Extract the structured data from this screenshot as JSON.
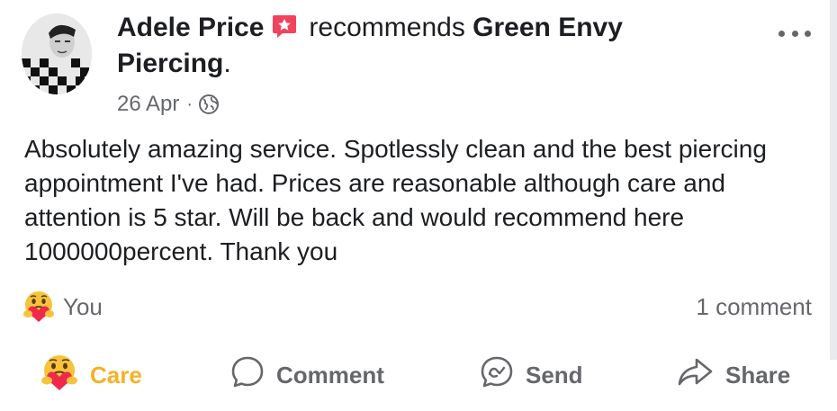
{
  "post": {
    "author": "Adele Price",
    "action_text": "recommends",
    "page_name": "Green Envy",
    "page_name_suffix": "Piercing",
    "period": ".",
    "date": "26 Apr",
    "separator": "·",
    "privacy_icon": "globe-icon",
    "more_icon": "more-options-icon",
    "body": "Absolutely amazing service. Spotlessly clean and the best piercing appointment I've had. Prices are reasonable although care and attention is 5 star. Will be back and would recommend here 1000000percent. Thank you"
  },
  "reactions": {
    "icon": "care-reaction-icon",
    "label": "You"
  },
  "comments": {
    "count_label": "1 comment"
  },
  "actions": {
    "care": "Care",
    "comment": "Comment",
    "send": "Send",
    "share": "Share"
  },
  "colors": {
    "text_primary": "#1c1e21",
    "text_secondary": "#65676b",
    "care_active": "#f7b125",
    "recommend_badge": "#f3425f"
  }
}
